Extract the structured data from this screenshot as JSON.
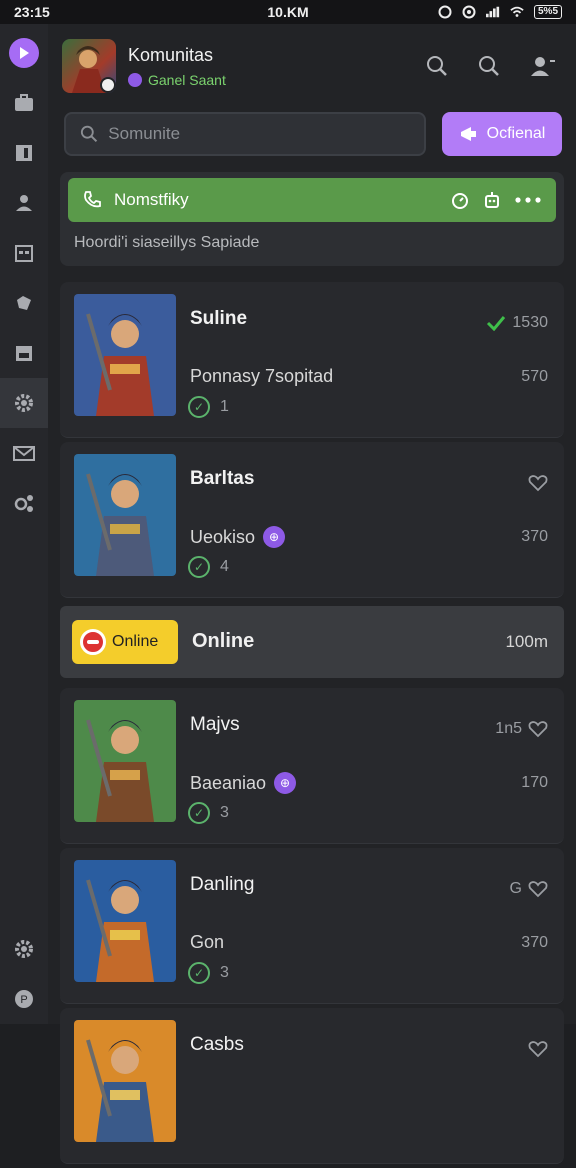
{
  "status": {
    "time": "23:15",
    "center": "10.KM",
    "battery": "5%5"
  },
  "rail": {
    "items": [
      "briefcase-icon",
      "book-icon",
      "person-icon",
      "calendar-icon",
      "puzzle-icon",
      "store-icon",
      "gear-icon",
      "mail-icon",
      "connections-icon"
    ],
    "active_index": 6
  },
  "header": {
    "title": "Komunitas",
    "subtitle": "Ganel Saant"
  },
  "search": {
    "placeholder": "Somunite",
    "button_label": "Ocfienal"
  },
  "notice": {
    "bar_label": "Nomstfiky",
    "description": "Hoordi'i siaseillys Sapiade"
  },
  "cards": [
    {
      "title": "Suline",
      "subtitle": "Ponnasy 7sopitad",
      "meta": "1",
      "right_top": "1530",
      "right_mid": "570",
      "badge": "",
      "colors": [
        "#3b5c9c",
        "#a33b2a",
        "#e2a54a"
      ]
    },
    {
      "title": "Barltas",
      "subtitle": "Ueokiso",
      "meta": "4",
      "right_top": "",
      "right_mid": "370",
      "badge": "purple",
      "colors": [
        "#2f6fa0",
        "#4d5a7a",
        "#c9a448"
      ]
    }
  ],
  "online": {
    "pill_label": "Online",
    "title": "Online",
    "right": "100m"
  },
  "cards2": [
    {
      "title": "Majvs",
      "subtitle": "Baeaniao",
      "meta": "3",
      "right_top": "1n5",
      "right_mid": "170",
      "badge": "purple",
      "colors": [
        "#4e8a4a",
        "#7a4a2a",
        "#d6a14a"
      ]
    },
    {
      "title": "Danling",
      "subtitle": "Gon",
      "meta": "3",
      "right_top": "G",
      "right_mid": "370",
      "badge": "",
      "colors": [
        "#2a5da0",
        "#c46a2a",
        "#e6c04a"
      ]
    },
    {
      "title": "Casbs",
      "subtitle": "",
      "meta": "",
      "right_top": "",
      "right_mid": "",
      "badge": "",
      "colors": [
        "#d98a2a",
        "#3a5a8a",
        "#e0c060"
      ]
    }
  ]
}
